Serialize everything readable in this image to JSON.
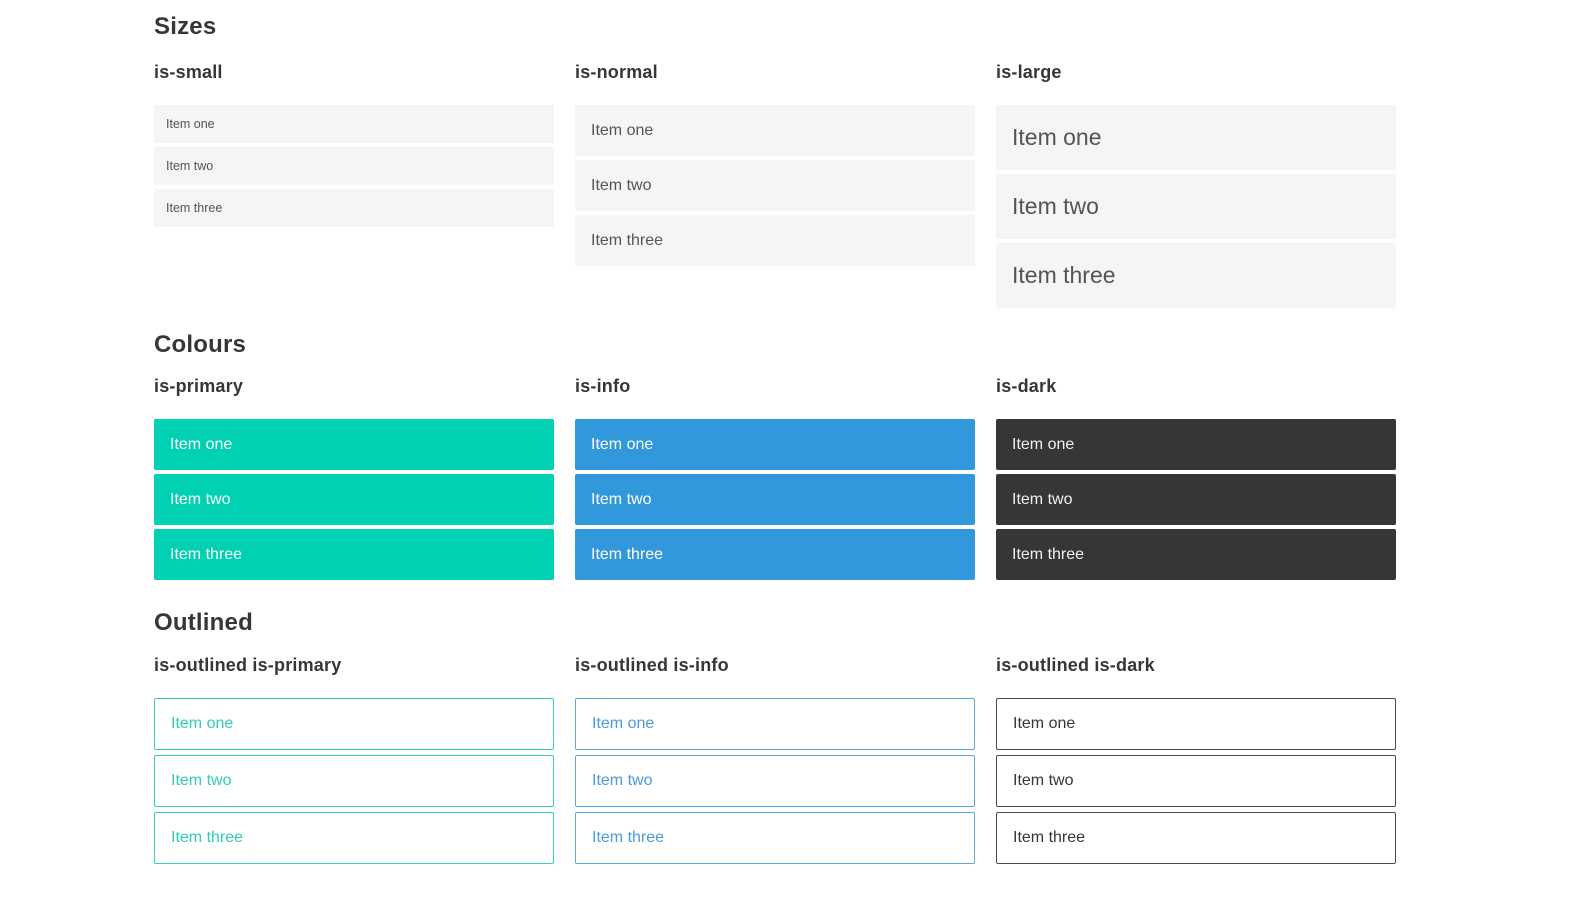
{
  "colors": {
    "primary": "#00d1b2",
    "info": "#3298dc",
    "dark": "#363636",
    "light_item_background": "#f5f5f5",
    "item_text": "#545454",
    "heading_text": "#363636",
    "page_background": "#ffffff"
  },
  "sections": [
    {
      "title": "Sizes",
      "groups": [
        {
          "label": "is-small",
          "items": [
            "Item one",
            "Item two",
            "Item three"
          ]
        },
        {
          "label": "is-normal",
          "items": [
            "Item one",
            "Item two",
            "Item three"
          ]
        },
        {
          "label": "is-large",
          "items": [
            "Item one",
            "Item two",
            "Item three"
          ]
        }
      ]
    },
    {
      "title": "Colours",
      "groups": [
        {
          "label": "is-primary",
          "items": [
            "Item one",
            "Item two",
            "Item three"
          ]
        },
        {
          "label": "is-info",
          "items": [
            "Item one",
            "Item two",
            "Item three"
          ]
        },
        {
          "label": "is-dark",
          "items": [
            "Item one",
            "Item two",
            "Item three"
          ]
        }
      ]
    },
    {
      "title": "Outlined",
      "groups": [
        {
          "label": "is-outlined is-primary",
          "items": [
            "Item one",
            "Item two",
            "Item three"
          ]
        },
        {
          "label": "is-outlined is-info",
          "items": [
            "Item one",
            "Item two",
            "Item three"
          ]
        },
        {
          "label": "is-outlined is-dark",
          "items": [
            "Item one",
            "Item two",
            "Item three"
          ]
        }
      ]
    }
  ]
}
